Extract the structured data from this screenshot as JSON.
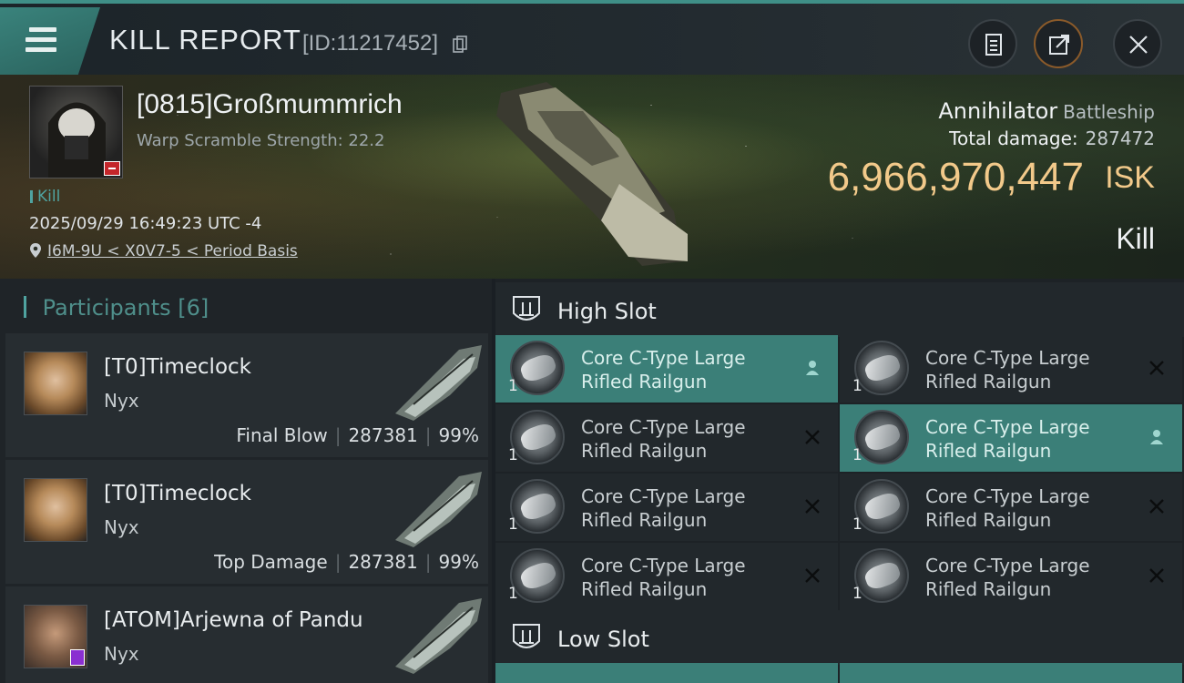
{
  "header": {
    "title": "KILL REPORT",
    "report_id": "[ID:11217452]"
  },
  "victim": {
    "name": "[0815]Großmummrich",
    "warp_scramble": "Warp Scramble Strength: 22.2",
    "kill_tag": "Kill",
    "datetime": "2025/09/29 16:49:23 UTC -4",
    "location": "I6M-9U < X0V7-5 < Period Basis",
    "ship_name": "Annihilator",
    "ship_class": "Battleship",
    "total_damage_label": "Total damage:",
    "total_damage": "287472",
    "isk_value": "6,966,970,447",
    "isk_unit": "ISK",
    "result": "Kill"
  },
  "participants": {
    "title": "Participants",
    "count": "[6]",
    "items": [
      {
        "name": "[T0]Timeclock",
        "ship": "Nyx",
        "role": "Final Blow",
        "damage": "287381",
        "percent": "99%"
      },
      {
        "name": "[T0]Timeclock",
        "ship": "Nyx",
        "role": "Top Damage",
        "damage": "287381",
        "percent": "99%"
      },
      {
        "name": "[ATOM]Arjewna of Pandu",
        "ship": "Nyx",
        "role": "",
        "damage": "",
        "percent": ""
      }
    ]
  },
  "high_slot": {
    "label": "High Slot",
    "modules": [
      {
        "name": "Core C-Type Large Rifled Railgun",
        "qty": "1",
        "state": "active"
      },
      {
        "name": "Core C-Type Large Rifled Railgun",
        "qty": "1",
        "state": "destroyed"
      },
      {
        "name": "Core C-Type Large Rifled Railgun",
        "qty": "1",
        "state": "destroyed"
      },
      {
        "name": "Core C-Type Large Rifled Railgun",
        "qty": "1",
        "state": "active"
      },
      {
        "name": "Core C-Type Large Rifled Railgun",
        "qty": "1",
        "state": "destroyed"
      },
      {
        "name": "Core C-Type Large Rifled Railgun",
        "qty": "1",
        "state": "destroyed"
      },
      {
        "name": "Core C-Type Large Rifled Railgun",
        "qty": "1",
        "state": "destroyed"
      },
      {
        "name": "Core C-Type Large Rifled Railgun",
        "qty": "1",
        "state": "destroyed"
      }
    ]
  },
  "low_slot": {
    "label": "Low Slot"
  },
  "colors": {
    "accent": "#3b7f78",
    "isk": "#f2c98a",
    "header_bar": "#3f8f87"
  },
  "icons": {
    "menu": "hamburger-icon",
    "copy": "copy-icon",
    "clipboard": "clipboard-icon",
    "share": "share-icon",
    "close": "close-icon",
    "location": "location-pin-icon",
    "slot": "slot-shield-icon",
    "person": "person-icon",
    "destroyed": "x-icon"
  }
}
